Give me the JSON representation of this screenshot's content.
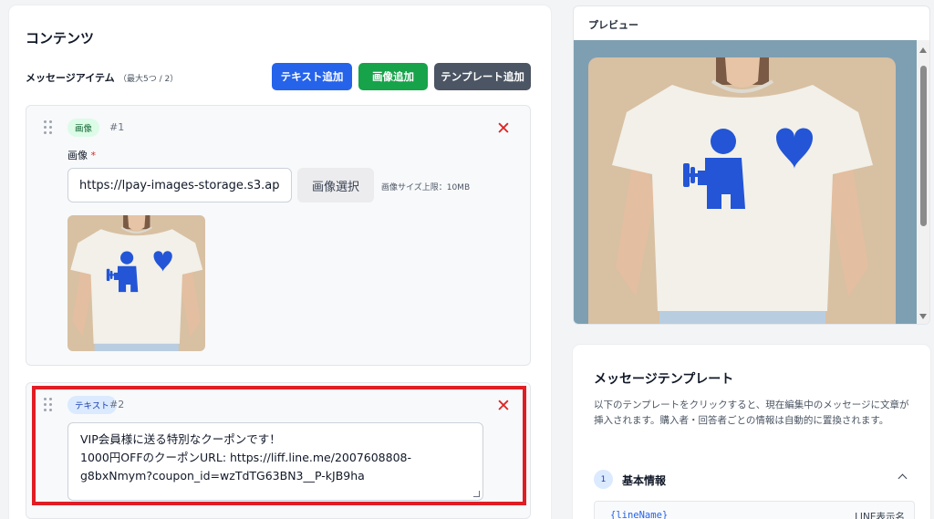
{
  "content": {
    "title": "コンテンツ",
    "items_label": "メッセージアイテム",
    "items_count": "（最大5つ / 2）",
    "buttons": {
      "add_text": "テキスト追加",
      "add_image": "画像追加",
      "add_template": "テンプレート追加"
    },
    "items": [
      {
        "badge": "画像",
        "number": "#1",
        "close": "✕",
        "field_label": "画像",
        "required_mark": "*",
        "url_value": "https://lpay-images-storage.s3.ap",
        "select_button": "画像選択",
        "size_note": "画像サイズ上限：10MB"
      },
      {
        "badge": "テキスト",
        "number": "#2",
        "close": "✕",
        "text_lines": [
          "VIP会員様に送る特別なクーポンです！",
          "1000円OFFのクーポンURL: https://liff.line.me/2007608808-",
          "g8bxNmym?coupon_id=wzTdTG63BN3__P-kJB9ha"
        ]
      }
    ]
  },
  "preview": {
    "title": "プレビュー"
  },
  "templates": {
    "title": "メッセージテンプレート",
    "description": "以下のテンプレートをクリックすると、現在編集中のメッセージに文章が挿入されます。購入者・回答者ごとの情報は自動的に置換されます。",
    "section": {
      "number": "1",
      "title": "基本情報",
      "variables": [
        {
          "code": "{lineName}",
          "desc": "LINE表示名"
        }
      ]
    }
  },
  "colors": {
    "add_text": "#2563eb",
    "add_image": "#16a34a",
    "add_template": "#4b5563",
    "close": "#dc2626",
    "highlight": "#e11d24",
    "preview_bg": "#7e9fb2",
    "tshirt_logo": "#2355d6"
  },
  "icons": {
    "drag": "drag-handle-icon",
    "close": "close-icon",
    "chevron": "chevron-up-icon",
    "resize": "resize-handle-icon"
  }
}
